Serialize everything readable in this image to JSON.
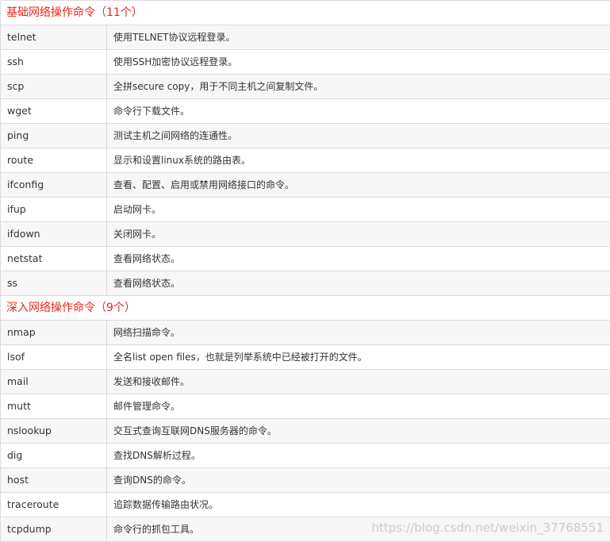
{
  "sections": [
    {
      "title": "基础网络操作命令（11个）",
      "rows": [
        {
          "cmd": "telnet",
          "desc": "使用TELNET协议远程登录。"
        },
        {
          "cmd": "ssh",
          "desc": "使用SSH加密协议远程登录。"
        },
        {
          "cmd": "scp",
          "desc": "全拼secure copy，用于不同主机之间复制文件。"
        },
        {
          "cmd": "wget",
          "desc": "命令行下载文件。"
        },
        {
          "cmd": "ping",
          "desc": "测试主机之间网络的连通性。"
        },
        {
          "cmd": "route",
          "desc": "显示和设置linux系统的路由表。"
        },
        {
          "cmd": "ifconfig",
          "desc": "查看、配置、启用或禁用网络接口的命令。"
        },
        {
          "cmd": "ifup",
          "desc": "启动网卡。"
        },
        {
          "cmd": "ifdown",
          "desc": "关闭网卡。"
        },
        {
          "cmd": "netstat",
          "desc": "查看网络状态。"
        },
        {
          "cmd": "ss",
          "desc": "查看网络状态。"
        }
      ]
    },
    {
      "title": "深入网络操作命令（9个）",
      "rows": [
        {
          "cmd": "nmap",
          "desc": "网络扫描命令。"
        },
        {
          "cmd": "lsof",
          "desc": "全名list open files，也就是列举系统中已经被打开的文件。"
        },
        {
          "cmd": "mail",
          "desc": "发送和接收邮件。"
        },
        {
          "cmd": "mutt",
          "desc": "邮件管理命令。"
        },
        {
          "cmd": "nslookup",
          "desc": "交互式查询互联网DNS服务器的命令。"
        },
        {
          "cmd": "dig",
          "desc": "查找DNS解析过程。"
        },
        {
          "cmd": "host",
          "desc": "查询DNS的命令。"
        },
        {
          "cmd": "traceroute",
          "desc": "追踪数据传输路由状况。"
        },
        {
          "cmd": "tcpdump",
          "desc": "命令行的抓包工具。"
        }
      ]
    }
  ],
  "watermark": "https://blog.csdn.net/weixin_37768551",
  "colors": {
    "section_title": "#e8271c",
    "border": "#dcdcdc",
    "row_alt_bg": "#f7f7f7"
  }
}
